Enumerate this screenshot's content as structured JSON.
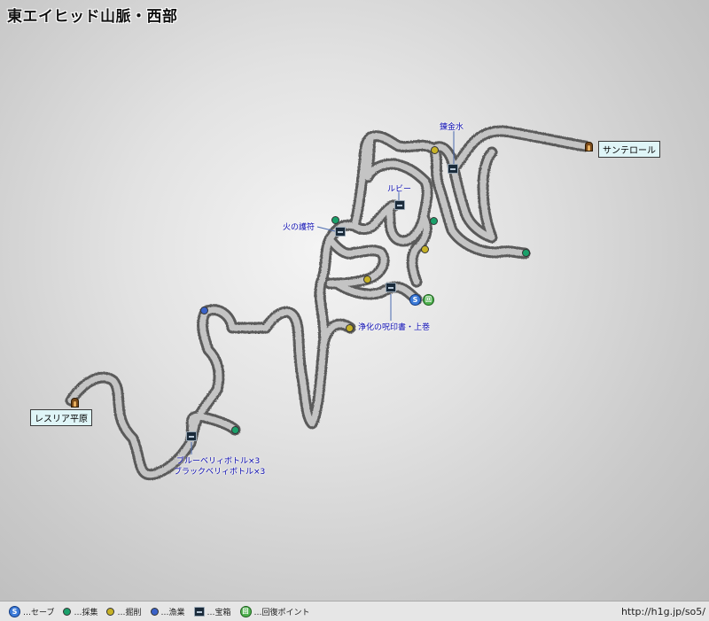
{
  "title": "東エイヒッド山脈・西部",
  "exits": {
    "east": "サンテロール",
    "west": "レスリア平原"
  },
  "treasure_labels": {
    "renkinsui": "錬金水",
    "ruby": "ルビー",
    "hi_no_gofu": "火の護符",
    "jouka": "浄化の呪印書・上巻",
    "bottles_1": "ブルーベリィボトル×3",
    "bottles_2": "ブラックベリィボトル×3"
  },
  "save_glyph": "S",
  "recover_glyph": "回",
  "legend": [
    {
      "icon": "save-icon",
      "label": "…セーブ"
    },
    {
      "icon": "gather-icon",
      "label": "…採集"
    },
    {
      "icon": "mining-icon",
      "label": "…掘削"
    },
    {
      "icon": "fishing-icon",
      "label": "…漁業"
    },
    {
      "icon": "treasure-chest-icon",
      "label": "…宝箱"
    },
    {
      "icon": "recovery-point-icon",
      "label": "…回復ポイント"
    }
  ],
  "url": "http://h1g.jp/so5/",
  "colors": {
    "gather": "#1aa06a",
    "mining": "#c7b226",
    "fishing": "#3a62c8",
    "save": "#3b7ad8",
    "recover": "#4db04d",
    "label_text": "#0a0ab0"
  }
}
